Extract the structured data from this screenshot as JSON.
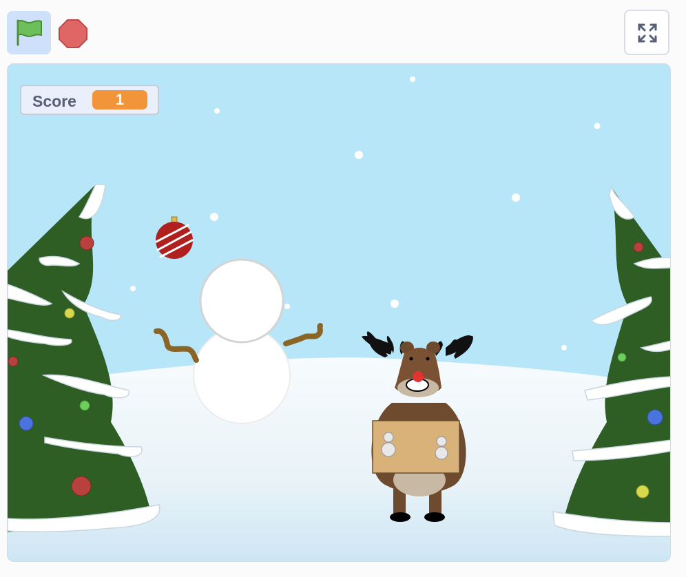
{
  "toolbar": {
    "flag": {
      "icon": "green-flag-icon",
      "color": "#5cb85c"
    },
    "stop": {
      "icon": "stop-sign-icon",
      "color": "#e06666"
    },
    "fullscreen": {
      "icon": "fullscreen-expand-icon"
    }
  },
  "stage": {
    "backdrop": "winter-snow-scene",
    "colors": {
      "sky": "#b7e6f9",
      "snow": "#eaf3f9",
      "tree": "#2e5e24",
      "score_value": "#f2953a"
    },
    "score_monitor": {
      "label": "Score",
      "value": "1"
    },
    "sprites": [
      "red-ornament",
      "snowman",
      "reindeer-with-box",
      "christmas-tree-left",
      "christmas-tree-right"
    ]
  }
}
